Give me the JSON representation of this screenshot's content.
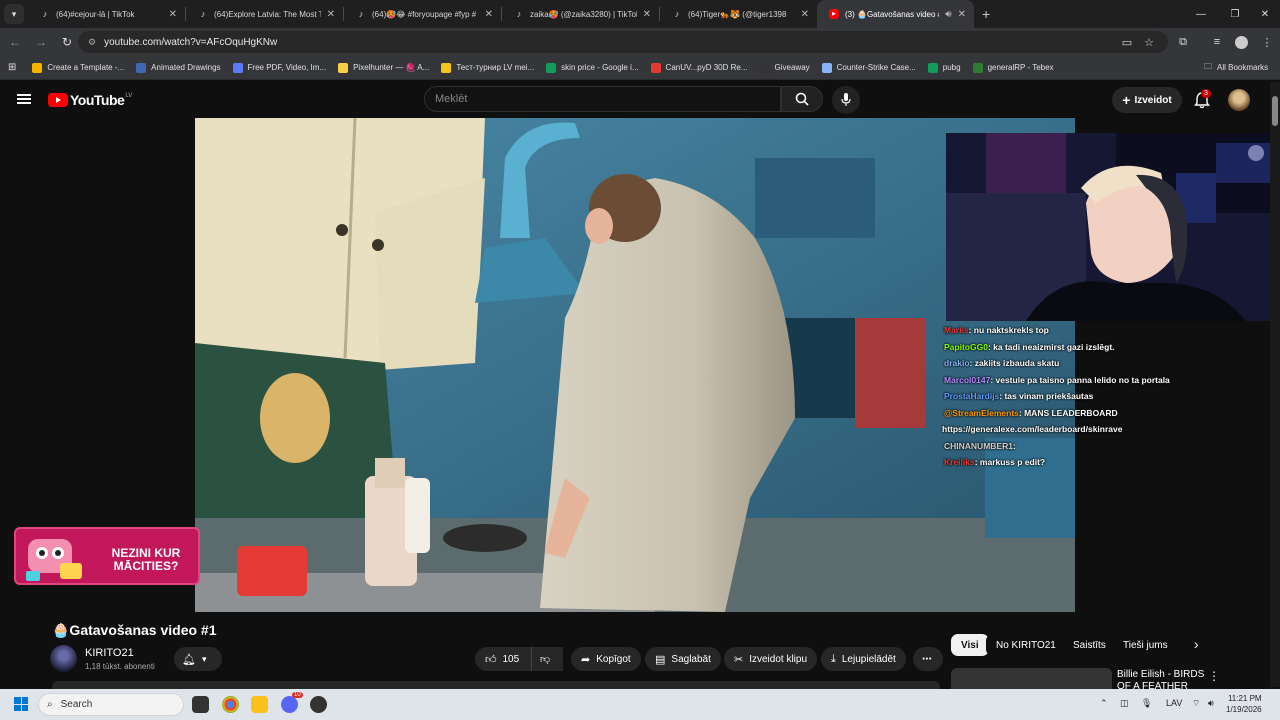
{
  "browser": {
    "tabs": [
      {
        "title": "(64)#cejour-lā | TikTok",
        "icon": "tiktok-icon",
        "active": false
      },
      {
        "title": "(64)Explore Latvia: The Most Te",
        "icon": "tiktok-icon",
        "active": false
      },
      {
        "title": "(64)🥵😂 #foryoupage #fyp #",
        "icon": "tiktok-icon",
        "active": false
      },
      {
        "title": "zaika🥵 (@zaika3280) | TikTok",
        "icon": "tiktok-icon",
        "active": false
      },
      {
        "title": "(64)Tiger🐅🐯 (@tiger1398",
        "icon": "tiktok-icon",
        "active": false
      },
      {
        "title": "(3) 🧁Gatavošanas video #",
        "icon": "youtube-icon",
        "active": true
      }
    ],
    "url": "youtube.com/watch?v=AFcOquHgKNw",
    "bookmarks": [
      {
        "label": "Create a Template -...",
        "color": "#f4b400"
      },
      {
        "label": "Animated Drawings",
        "color": "#4267b2"
      },
      {
        "label": "Free PDF, Video, Im...",
        "color": "#5b7cfa"
      },
      {
        "label": "Pixelhunter — 🧶 A...",
        "color": "#f7d046"
      },
      {
        "label": "Тест-турнир LV mei...",
        "color": "#f5c518"
      },
      {
        "label": "skin price - Google i...",
        "color": "#0f9d58"
      },
      {
        "label": "CanUV...pyD 30D Re...",
        "color": "#e53935"
      },
      {
        "label": "Giveaway",
        "color": "#333333"
      },
      {
        "label": "Counter-Strike Case...",
        "color": "#8ab4f8"
      },
      {
        "label": "pubg",
        "color": "#0f9d58"
      },
      {
        "label": "generalRP - Tebex",
        "color": "#2e7d32"
      }
    ],
    "all_bookmarks": "All Bookmarks"
  },
  "youtube": {
    "logo_text": "YouTube",
    "country_code": "LV",
    "search_placeholder": "Meklēt",
    "create_label": "Izveidot",
    "notification_count": "3"
  },
  "stream_chat": [
    {
      "user": "Marks",
      "text": ": nu naktskrekls top",
      "color": "#e53935"
    },
    {
      "user": "PapitoGG0",
      "text": ": ka tadi neaizmirst gazi izslēgt.",
      "color": "#7cfc00"
    },
    {
      "user": "drakio",
      "text": ": zakiits izbauda skatu",
      "color": "#8ab4f8"
    },
    {
      "user": "Marcol0147",
      "text": ": vestule pa taisno panna lelido no ta portala",
      "color": "#b388ff"
    },
    {
      "user": "ProstaHardijs",
      "text": ": tas vinam priekšautas",
      "color": "#5c9dff"
    },
    {
      "user": "@StreamElements",
      "text": ": MANS LEADERBOARD",
      "color": "#ff9800"
    },
    {
      "user": "",
      "text": "https://generalexe.com/leaderboard/skinrave",
      "color": "#ffffff"
    },
    {
      "user": "CHINANUMBER1",
      "text": ":",
      "color": "#d0d0d0"
    },
    {
      "user": "Kreiliks",
      "text": ": markuss p edit?",
      "color": "#e53935"
    }
  ],
  "promo_text": "NEZINI KUR MĀCITIES?",
  "video": {
    "title": "🧁Gatavošanas video #1",
    "channel": "KIRITO21",
    "subscribers": "1,18 tūkst. abonenti",
    "likes": "105",
    "share_label": "Kopīgot",
    "save_label": "Saglabāt",
    "clip_label": "Izveidot klipu",
    "download_label": "Lejupielādēt"
  },
  "chips": [
    "Visi",
    "No KIRITO21",
    "Saistīts",
    "Tieši jums"
  ],
  "recommendation": {
    "title": "Billie Eilish - BIRDS OF A FEATHER"
  },
  "taskbar": {
    "search_placeholder": "Search",
    "lang": "LAV",
    "time": "11:21 PM",
    "date": "1/19/2026",
    "discord_badge": "10"
  }
}
